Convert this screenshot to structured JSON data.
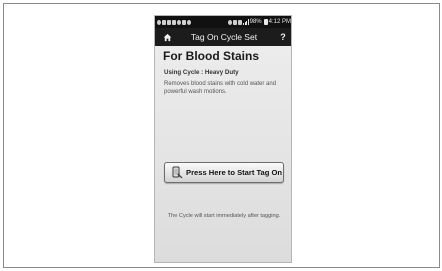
{
  "status_bar": {
    "battery": "98%",
    "time": "4:12 PM"
  },
  "title_bar": {
    "title": "Tag On Cycle Set",
    "home_icon": "home-icon",
    "help_label": "?"
  },
  "main": {
    "heading": "For Blood Stains",
    "cycle_line": "Using Cycle : Heavy Duty",
    "description": "Removes blood stains with cold water and powerful wash motions.",
    "start_button_label": "Press Here to Start Tag On",
    "start_button_icon": "tag-phone-icon",
    "note": "The Cycle will start immediately after tagging."
  },
  "colors": {
    "title_bar_bg": "#1c1c1c",
    "content_bg": "#e3e3e3",
    "button_border": "#6d6d6d"
  }
}
